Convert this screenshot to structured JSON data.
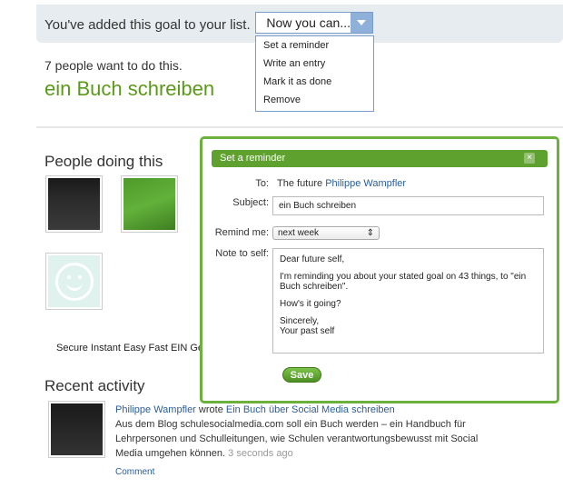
{
  "banner": {
    "text": "You've added this goal to your list."
  },
  "dropdown": {
    "label": "Now you can...",
    "items": [
      "Set a reminder",
      "Write an entry",
      "Mark it as done",
      "Remove"
    ]
  },
  "goal": {
    "count_text": "7 people want to do this.",
    "title": "ein Buch schreiben"
  },
  "people": {
    "title": "People doing this"
  },
  "secure_text": "Secure Instant Easy Fast EIN Ge",
  "recent": {
    "title": "Recent activity",
    "name": "Philippe Wampfler",
    "action": "wrote",
    "entry_title": "Ein Buch über Social Media schreiben",
    "body": "Aus dem Blog schulesocialmedia.com soll ein Buch werden – ein Handbuch für Lehrpersonen und Schulleitungen, wie Schulen verantwortungsbewusst mit Social Media umgehen können.",
    "time": "3 seconds ago",
    "comment": "Comment"
  },
  "dialog": {
    "title": "Set a reminder",
    "close": "×",
    "to_label": "To:",
    "to_prefix": "The future",
    "to_name": "Philippe Wampfler",
    "subject_label": "Subject:",
    "subject_value": "ein Buch schreiben",
    "remind_label": "Remind me:",
    "remind_value": "next week",
    "select_arrow": "⇕",
    "note_label": "Note to self:",
    "note": {
      "line1": "Dear future self,",
      "line2": "I'm reminding you about your stated goal on 43 things, to \"ein Buch schreiben\".",
      "line3": "How's it going?",
      "line4": "Sincerely,",
      "line5": "Your past self"
    },
    "save": "Save"
  },
  "colors": {
    "accent_green": "#5fa12f",
    "link_blue": "#2a5d9c",
    "banner_bg": "#e7ecf1"
  }
}
